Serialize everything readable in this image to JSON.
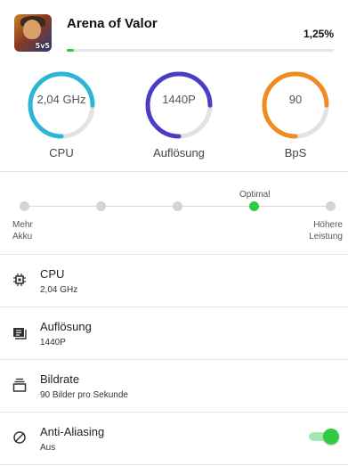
{
  "app": {
    "title": "Arena of Valor",
    "icon_badge": "5v5",
    "progress_text": "1,25%",
    "progress_value": 1.25
  },
  "gauges": [
    {
      "value": "2,04 GHz",
      "label": "CPU",
      "color": "#2bb5d6",
      "level": 0.75
    },
    {
      "value": "1440P",
      "label": "Auflösung",
      "color": "#4b3cc8",
      "level": 0.75
    },
    {
      "value": "90",
      "label": "BpS",
      "color": "#f28a1f",
      "level": 0.75
    }
  ],
  "slider": {
    "left_caption": "Mehr\nAkku",
    "right_caption": "Höhere\nLeistung",
    "selected_label": "Optimal",
    "positions": 5,
    "selected_index": 3
  },
  "settings": [
    {
      "title": "CPU",
      "value": "2,04 GHz",
      "icon": "cpu-icon"
    },
    {
      "title": "Auflösung",
      "value": "1440P",
      "icon": "resolution-icon"
    },
    {
      "title": "Bildrate",
      "value": "90 Bilder pro Sekunde",
      "icon": "framerate-icon"
    },
    {
      "title": "Anti-Aliasing",
      "value": "Aus",
      "icon": "anti-aliasing-icon",
      "toggle_on": true
    }
  ],
  "colors": {
    "accent": "#2ecc40"
  }
}
